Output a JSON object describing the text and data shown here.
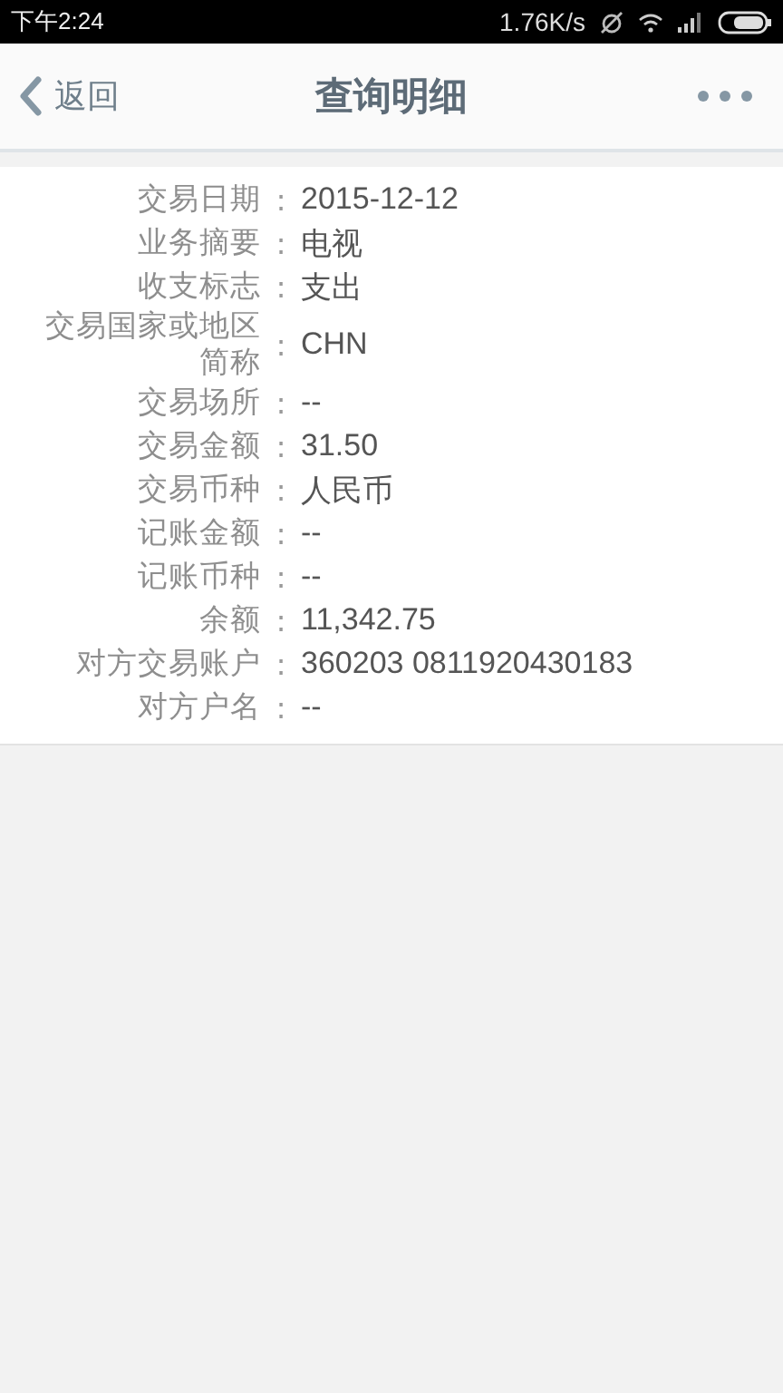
{
  "status_bar": {
    "time": "下午2:24",
    "speed": "1.76K/s"
  },
  "header": {
    "back": "返回",
    "title": "查询明细"
  },
  "rows": [
    {
      "label": "交易日期",
      "colon": ":",
      "value": "2015-12-12"
    },
    {
      "label": "业务摘要",
      "colon": ":",
      "value": "电视"
    },
    {
      "label": "收支标志",
      "colon": ":",
      "value": "支出"
    },
    {
      "label": "交易国家或地区简称",
      "colon": ":",
      "value": "CHN"
    },
    {
      "label": "交易场所",
      "colon": ":",
      "value": "--"
    },
    {
      "label": "交易金额",
      "colon": ":",
      "value": "31.50"
    },
    {
      "label": "交易币种",
      "colon": ":",
      "value": "人民币"
    },
    {
      "label": "记账金额",
      "colon": ":",
      "value": "--"
    },
    {
      "label": "记账币种",
      "colon": ":",
      "value": "--"
    },
    {
      "label": "余额",
      "colon": ":",
      "value": "11,342.75"
    },
    {
      "label": "对方交易账户",
      "colon": ":",
      "value": "360203 0811920430183"
    },
    {
      "label": "对方户名",
      "colon": ":",
      "value": "--"
    }
  ]
}
